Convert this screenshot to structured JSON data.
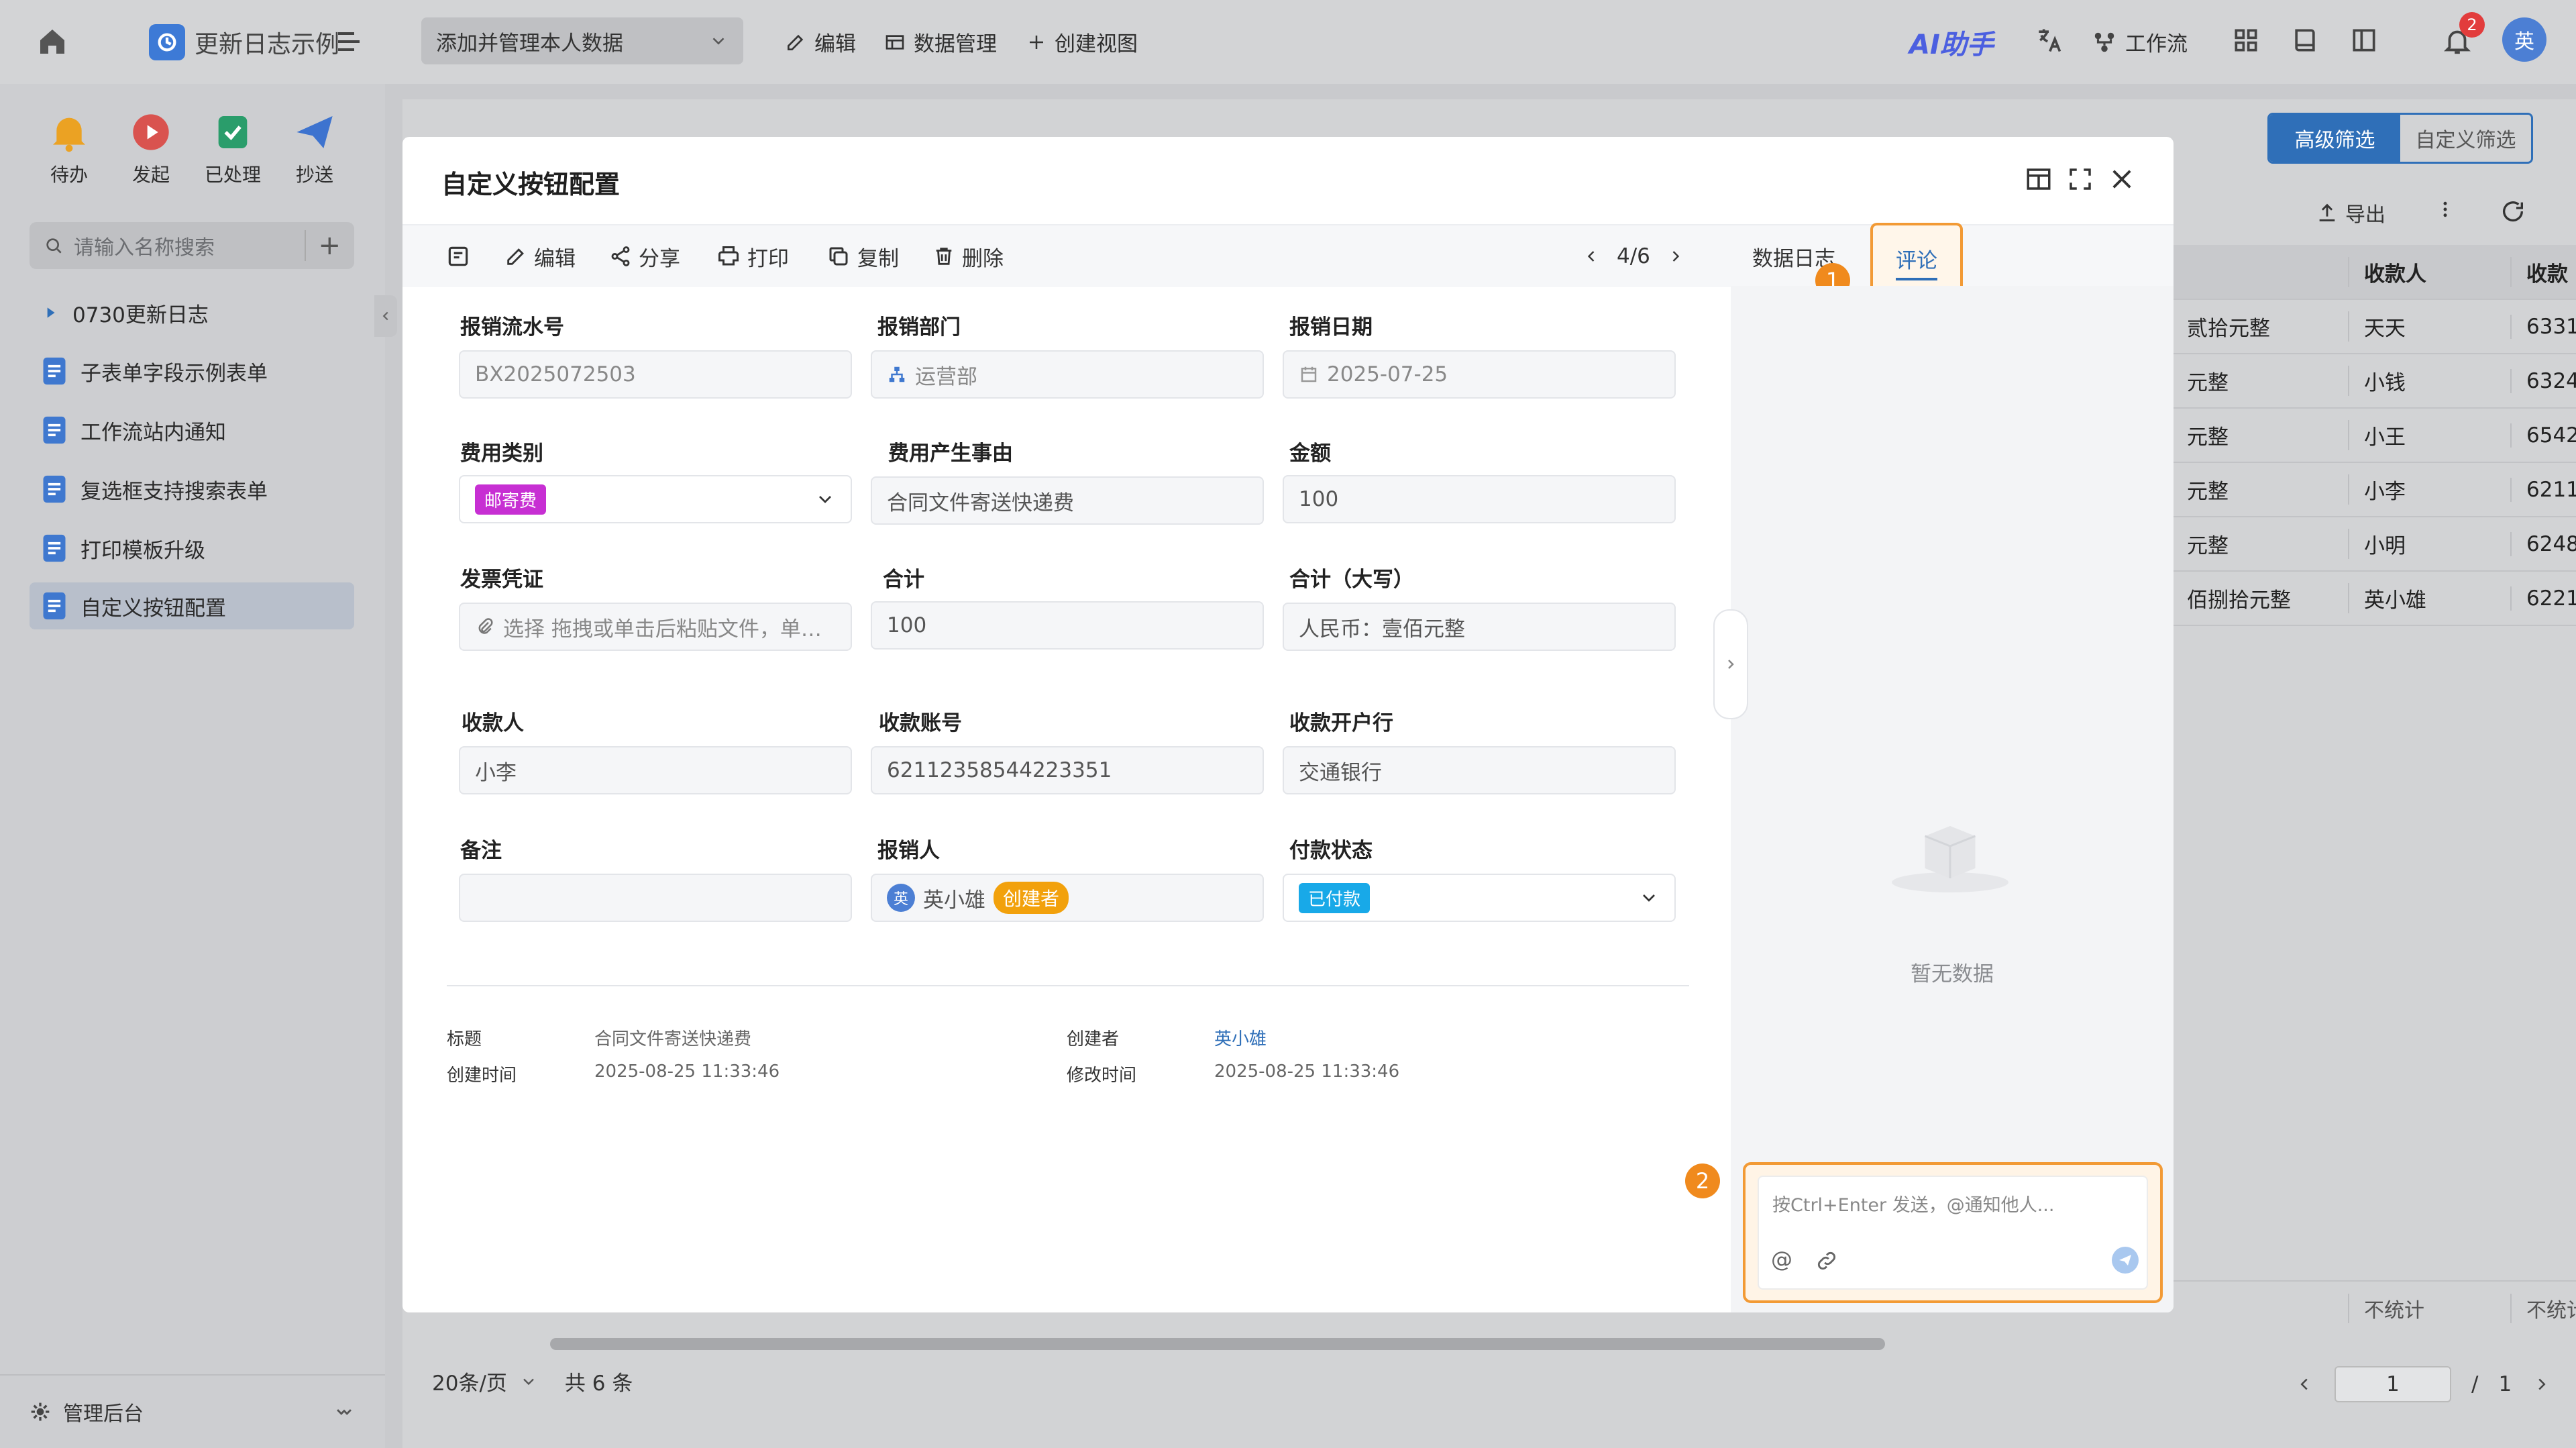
{
  "colors": {
    "accent": "#2f6fb8",
    "orange_highlight": "#f29a35",
    "tag_mail": "#c72fd3",
    "tag_paid": "#18a9e8",
    "creator_badge": "#f2a10c",
    "notification": "#e23c3c"
  },
  "topbar": {
    "app_title": "更新日志示例",
    "view_select": "添加并管理本人数据",
    "edit": "编辑",
    "data_manage": "数据管理",
    "create_view": "创建视图",
    "ai_assistant": "AI助手",
    "workflow": "工作流",
    "notification_count": "2",
    "avatar": "英"
  },
  "sidebar": {
    "quick_actions": [
      {
        "label": "待办",
        "icon": "bell-icon"
      },
      {
        "label": "发起",
        "icon": "play-icon"
      },
      {
        "label": "已处理",
        "icon": "check-doc-icon"
      },
      {
        "label": "抄送",
        "icon": "paper-plane-icon"
      }
    ],
    "search_placeholder": "请输入名称搜索",
    "items": [
      {
        "label": "0730更新日志"
      },
      {
        "label": "子表单字段示例表单"
      },
      {
        "label": "工作流站内通知"
      },
      {
        "label": "复选框支持搜索表单"
      },
      {
        "label": "打印模板升级"
      },
      {
        "label": "自定义按钮配置"
      }
    ],
    "footer": "管理后台"
  },
  "background": {
    "filter_advanced": "高级筛选",
    "filter_custom": "自定义筛选",
    "export": "导出",
    "table": {
      "headers": [
        "",
        "收款人",
        "收款"
      ],
      "rows": [
        [
          "贰拾元整",
          "天天",
          "6331"
        ],
        [
          "元整",
          "小钱",
          "6324"
        ],
        [
          "元整",
          "小王",
          "6542"
        ],
        [
          "元整",
          "小李",
          "6211"
        ],
        [
          "元整",
          "小明",
          "6248"
        ],
        [
          "佰捌拾元整",
          "英小雄",
          "6221"
        ]
      ],
      "summary_a": "不统计",
      "summary_b": "不统计"
    },
    "page_size": "20条/页",
    "total": "共 6 条",
    "page_current": "1",
    "page_separator": "/",
    "page_total": "1"
  },
  "modal": {
    "title": "自定义按钮配置",
    "toolbar": {
      "edit": "编辑",
      "share": "分享",
      "print": "打印",
      "copy": "复制",
      "delete": "删除",
      "record_position": "4/6"
    },
    "tabs": {
      "data_log": "数据日志",
      "comments": "评论"
    },
    "fields": {
      "serial_label": "报销流水号",
      "serial_value": "BX2025072503",
      "dept_label": "报销部门",
      "dept_value": "运营部",
      "date_label": "报销日期",
      "date_value": "2025-07-25",
      "category_label": "费用类别",
      "category_value": "邮寄费",
      "reason_label": "费用产生事由",
      "reason_value": "合同文件寄送快递费",
      "amount_label": "金额",
      "amount_value": "100",
      "invoice_label": "发票凭证",
      "invoice_placeholder": "选择 拖拽或单击后粘贴文件，单…",
      "total_label": "合计",
      "total_value": "100",
      "total_upper_label": "合计（大写）",
      "total_upper_value": "人民币：壹佰元整",
      "payee_label": "收款人",
      "payee_value": "小李",
      "account_label": "收款账号",
      "account_value": "62112358544223351",
      "bank_label": "收款开户行",
      "bank_value": "交通银行",
      "remark_label": "备注",
      "remark_value": "",
      "claimant_label": "报销人",
      "claimant_avatar": "英",
      "claimant_value": "英小雄",
      "claimant_badge": "创建者",
      "pay_status_label": "付款状态",
      "pay_status_value": "已付款"
    },
    "meta": {
      "title_label": "标题",
      "title_value": "合同文件寄送快递费",
      "creator_label": "创建者",
      "creator_value": "英小雄",
      "created_label": "创建时间",
      "created_value": "2025-08-25 11:33:46",
      "modified_label": "修改时间",
      "modified_value": "2025-08-25 11:33:46"
    },
    "comments": {
      "empty": "暂无数据",
      "input_placeholder": "按Ctrl+Enter 发送，@通知他人..."
    },
    "step_badges": [
      "1",
      "2"
    ]
  }
}
